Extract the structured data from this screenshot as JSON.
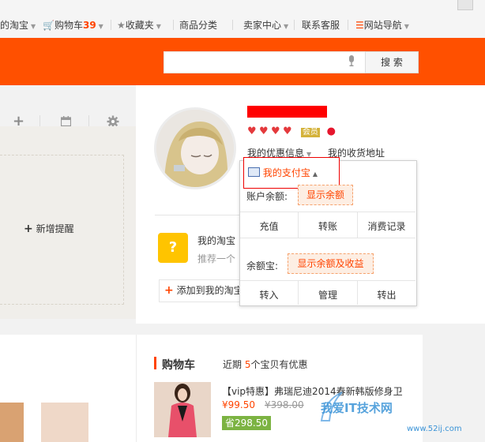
{
  "nav": {
    "my_taobao": "的淘宝",
    "cart_label": "购物车",
    "cart_count": "39",
    "favorites": "收藏夹",
    "categories": "商品分类",
    "seller_center": "卖家中心",
    "contact_service": "联系客服",
    "site_nav": "网站导航"
  },
  "header": {
    "search_button": "搜 索",
    "search_placeholder": ""
  },
  "left_card": {
    "add_reminder": "新增提醒"
  },
  "profile": {
    "member_badge": "会员",
    "coupon_info": "我的优惠信息",
    "address": "我的收货地址",
    "my_taobao_label": "我的淘宝",
    "recommend": "推荐一个",
    "add_to_my_taobao": "添加到我的淘宝"
  },
  "alipay": {
    "title": "我的支付宝",
    "balance_label": "账户余额:",
    "show_balance": "显示余额",
    "recharge": "充值",
    "transfer": "转账",
    "records": "消费记录",
    "yuebao_label": "余额宝:",
    "show_yuebao": "显示余额及收益",
    "transfer_in": "转入",
    "manage": "管理",
    "transfer_out": "转出"
  },
  "cart": {
    "title": "购物车",
    "note_prefix": "近期",
    "note_count": "5",
    "note_suffix": "个宝贝有优惠",
    "product_title": "【vip特惠】弗瑞尼迪2014春新韩版修身卫",
    "price": "¥99.50",
    "old_price": "¥398.00",
    "save": "省298.50"
  },
  "watermark": {
    "text": "我爱IT技术网",
    "url": "www.52ij.com"
  },
  "colors": {
    "brand_orange": "#ff5000",
    "accent": "#f40",
    "highlight_red": "#e00"
  }
}
